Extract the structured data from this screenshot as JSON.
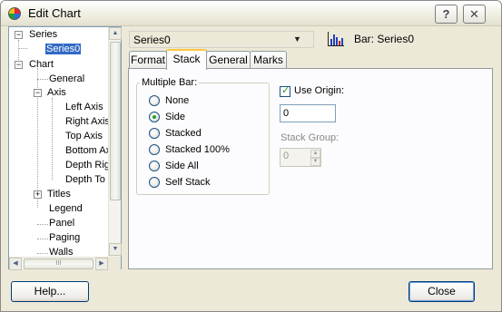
{
  "window": {
    "title": "Edit Chart",
    "help_glyph": "?",
    "close_glyph": "✕"
  },
  "tree": {
    "items": [
      {
        "label": "Series"
      },
      {
        "label": "Series0"
      },
      {
        "label": "Chart"
      },
      {
        "label": "General"
      },
      {
        "label": "Axis"
      },
      {
        "label": "Left Axis"
      },
      {
        "label": "Right Axis"
      },
      {
        "label": "Top Axis"
      },
      {
        "label": "Bottom Ax"
      },
      {
        "label": "Depth Rig"
      },
      {
        "label": "Depth To"
      },
      {
        "label": "Titles"
      },
      {
        "label": "Legend"
      },
      {
        "label": "Panel"
      },
      {
        "label": "Paging"
      },
      {
        "label": "Walls"
      }
    ],
    "scroll_up": "▲",
    "scroll_down": "▼",
    "scroll_left": "◀",
    "scroll_right": "▶",
    "grip": "III",
    "vgrip": "≡",
    "minus": "−",
    "plus": "+"
  },
  "series_selector": {
    "value": "Series0",
    "arrow": "▼"
  },
  "series_type_label": "Bar: Series0",
  "tabs": [
    {
      "label": "Format"
    },
    {
      "label": "Stack"
    },
    {
      "label": "General"
    },
    {
      "label": "Marks"
    }
  ],
  "stack_tab": {
    "multiple_bar": {
      "label": "Multiple Bar:",
      "options": [
        {
          "label": "None",
          "selected": false
        },
        {
          "label": "Side",
          "selected": true
        },
        {
          "label": "Stacked",
          "selected": false
        },
        {
          "label": "Stacked 100%",
          "selected": false
        },
        {
          "label": "Side All",
          "selected": false
        },
        {
          "label": "Self Stack",
          "selected": false
        }
      ]
    },
    "use_origin": {
      "label": "Use Origin:",
      "checked": true,
      "value": "0"
    },
    "stack_group": {
      "label": "Stack Group:",
      "value": "0",
      "up": "▲",
      "down": "▼"
    }
  },
  "buttons": {
    "help": "Help...",
    "close": "Close"
  },
  "colors": {
    "selection": "#316ac5",
    "accent_tab": "#ffc83c",
    "radio_dot": "#21a121"
  }
}
